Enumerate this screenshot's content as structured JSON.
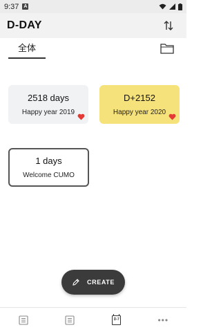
{
  "status_bar": {
    "time": "9:37",
    "app_icon_letter": "A"
  },
  "app_bar": {
    "title": "D-DAY",
    "sort_icon": "sort-arrows-icon"
  },
  "tabs": {
    "active_label": "全体",
    "folder_icon": "folder-icon"
  },
  "cards": [
    {
      "count": "2518 days",
      "name": "Happy year 2019",
      "has_heart": true,
      "color": "#f1f2f4"
    },
    {
      "count": "D+2152",
      "name": "Happy year 2020",
      "has_heart": true,
      "color": "#f6e27a"
    },
    {
      "count": "1 days",
      "name": "Welcome CUMO",
      "has_heart": false,
      "color": "#ffffff"
    }
  ],
  "fab": {
    "label": "CREATE",
    "icon": "pencil-icon"
  },
  "bottom_nav": {
    "items": [
      {
        "icon": "list-icon"
      },
      {
        "icon": "list-icon"
      },
      {
        "icon": "dday-calendar-icon",
        "label": "D-7",
        "active": true
      },
      {
        "icon": "more-icon"
      }
    ]
  },
  "colors": {
    "heart": "#e53935",
    "fab": "#3b3b3b",
    "highlight_card": "#f6e27a"
  }
}
